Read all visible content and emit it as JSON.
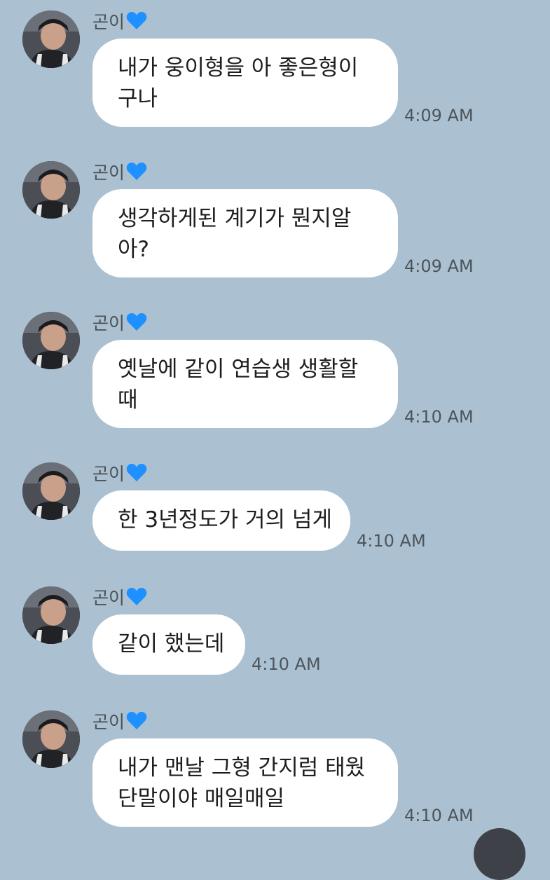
{
  "chat": {
    "messages": [
      {
        "sender": "곤이",
        "lines": [
          "내가 웅이형을 아 좋은형이",
          "구나"
        ],
        "time": "4:09 AM"
      },
      {
        "sender": "곤이",
        "lines": [
          "생각하게된 계기가 뭔지알",
          "아?"
        ],
        "time": "4:09 AM"
      },
      {
        "sender": "곤이",
        "lines": [
          "옛날에 같이 연습생 생활할",
          "때"
        ],
        "time": "4:10 AM"
      },
      {
        "sender": "곤이",
        "lines": [
          "한 3년정도가 거의 넘게"
        ],
        "time": "4:10 AM"
      },
      {
        "sender": "곤이",
        "lines": [
          "같이 했는데"
        ],
        "time": "4:10 AM"
      },
      {
        "sender": "곤이",
        "lines": [
          "내가 맨날 그형 간지럼 태웠",
          "단말이야 매일매일"
        ],
        "time": "4:10 AM"
      }
    ]
  },
  "icons": {
    "sender_badge": "blue-heart-icon",
    "heart_color": "#1e90ff",
    "scroll_button": "scroll-down-button"
  },
  "colors": {
    "background": "#abc1d1",
    "bubble": "#ffffff",
    "text": "#1e1e1e"
  }
}
